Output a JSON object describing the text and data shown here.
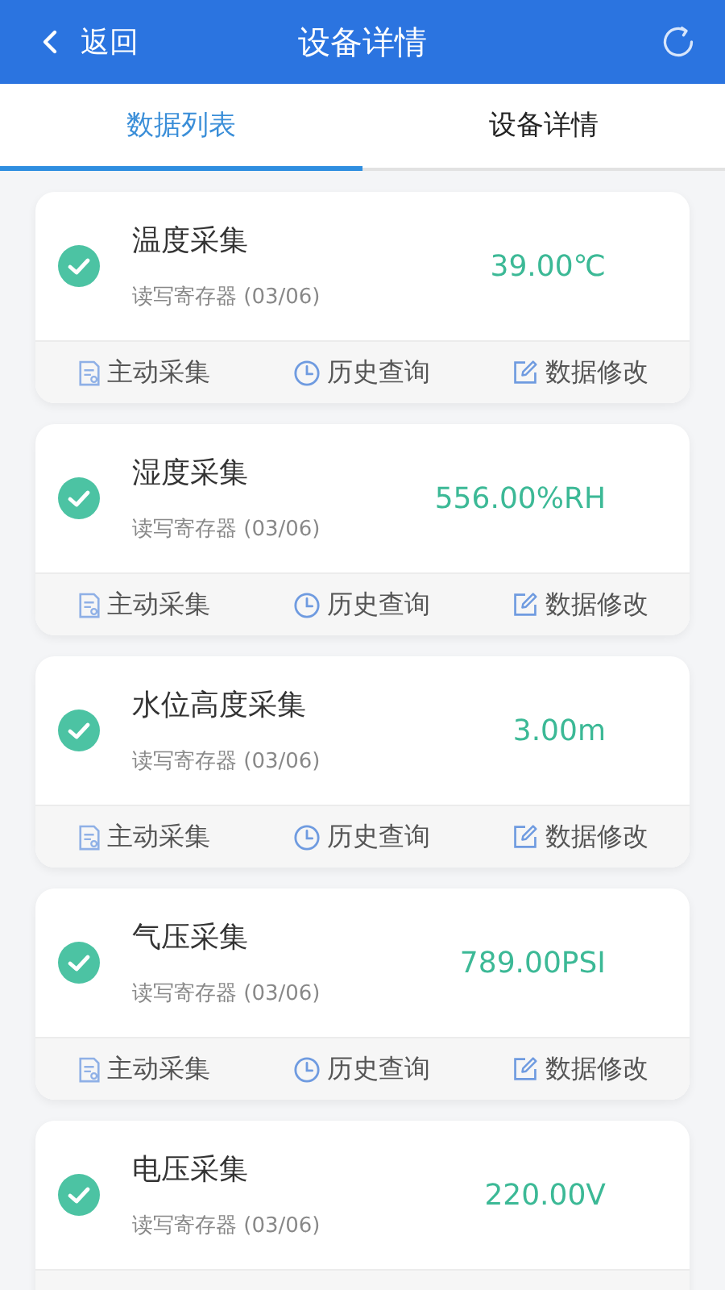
{
  "header": {
    "back": "返回",
    "title": "设备详情"
  },
  "tabs": [
    {
      "label": "数据列表",
      "selected": true
    },
    {
      "label": "设备详情",
      "selected": false
    }
  ],
  "items": [
    {
      "name": "温度采集",
      "register": "读写寄存器 (03/06)",
      "value": "39.00℃",
      "checked": true,
      "actions": [
        "主动采集",
        "历史查询",
        "数据修改"
      ]
    },
    {
      "name": "湿度采集",
      "register": "读写寄存器 (03/06)",
      "value": "556.00%RH",
      "checked": true,
      "actions": [
        "主动采集",
        "历史查询",
        "数据修改"
      ]
    },
    {
      "name": "水位高度采集",
      "register": "读写寄存器 (03/06)",
      "value": "3.00m",
      "checked": true,
      "actions": [
        "主动采集",
        "历史查询",
        "数据修改"
      ]
    },
    {
      "name": "气压采集",
      "register": "读写寄存器 (03/06)",
      "value": "789.00PSI",
      "checked": true,
      "actions": [
        "主动采集",
        "历史查询",
        "数据修改"
      ]
    },
    {
      "name": "电压采集",
      "register": "读写寄存器 (03/06)",
      "value": "220.00V",
      "checked": true
    }
  ]
}
